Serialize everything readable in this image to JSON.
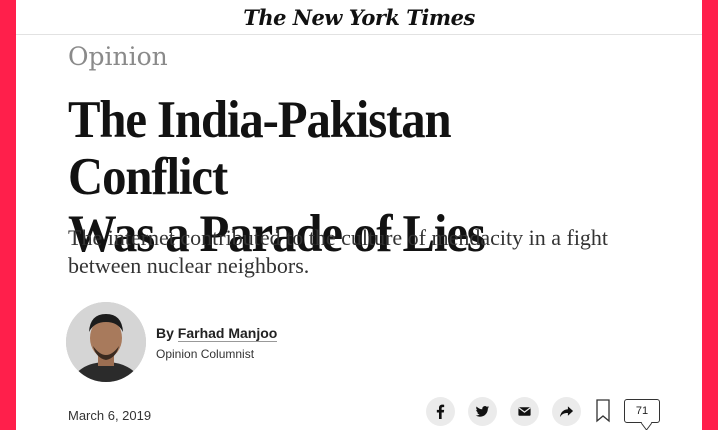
{
  "masthead": {
    "logo_text": "The New York Times"
  },
  "article": {
    "section": "Opinion",
    "headline_line1": "The India-Pakistan Conflict",
    "headline_line2": "Was a Parade of Lies",
    "summary": "The internet contributed to the culture of mendacity in a fight between nuclear neighbors.",
    "byline_prefix": "By",
    "author": "Farhad Manjoo",
    "author_role": "Opinion Columnist",
    "date": "March 6, 2019"
  },
  "share_bar": {
    "icons": [
      "facebook-icon",
      "twitter-icon",
      "email-icon",
      "share-icon",
      "bookmark-icon",
      "comments-icon"
    ],
    "comment_count": "71"
  },
  "colors": {
    "frame_accent": "#ff1f4b",
    "share_button_bg": "#ebebeb"
  }
}
